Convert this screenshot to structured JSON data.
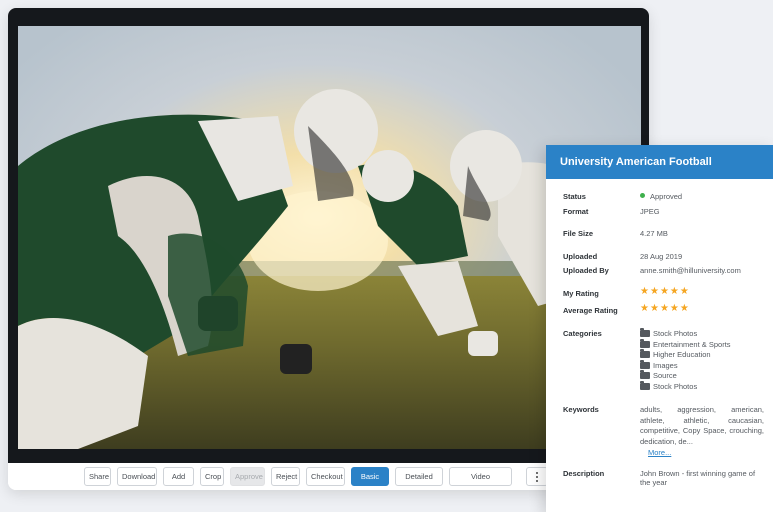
{
  "toolbar": {
    "share": "Share",
    "download": "Download",
    "add_to": "Add to",
    "crop": "Crop",
    "approve": "Approve",
    "reject": "Reject",
    "checkout": "Checkout",
    "basic_info": "Basic info",
    "detailed_info": "Detailed Info",
    "video_intelligence": "Video Intelligence"
  },
  "panel": {
    "title": "University American Football",
    "status": {
      "label": "Status",
      "value": "Approved",
      "color": "#3fb04c"
    },
    "format": {
      "label": "Format",
      "value": "JPEG"
    },
    "file_size": {
      "label": "File Size",
      "value": "4.27 MB"
    },
    "uploaded": {
      "label": "Uploaded",
      "value": "28 Aug 2019"
    },
    "uploaded_by": {
      "label": "Uploaded By",
      "value": "anne.smith@hilluniversity.com"
    },
    "my_rating": {
      "label": "My Rating",
      "stars": 5
    },
    "average_rating": {
      "label": "Average Rating",
      "stars": 5
    },
    "categories": {
      "label": "Categories",
      "items": [
        "Stock Photos",
        "Entertainment & Sports",
        "Higher Education",
        "Images",
        "Source",
        "Stock Photos"
      ]
    },
    "keywords": {
      "label": "Keywords",
      "value": "adults, aggression, american, athlete, athletic, caucasian, competitive, Copy Space, crouching, dedication, de...",
      "more": "More..."
    },
    "description": {
      "label": "Description",
      "value": "John Brown - first winning game of the year"
    }
  },
  "colors": {
    "accent": "#2b82c7",
    "star": "#f5a623"
  }
}
